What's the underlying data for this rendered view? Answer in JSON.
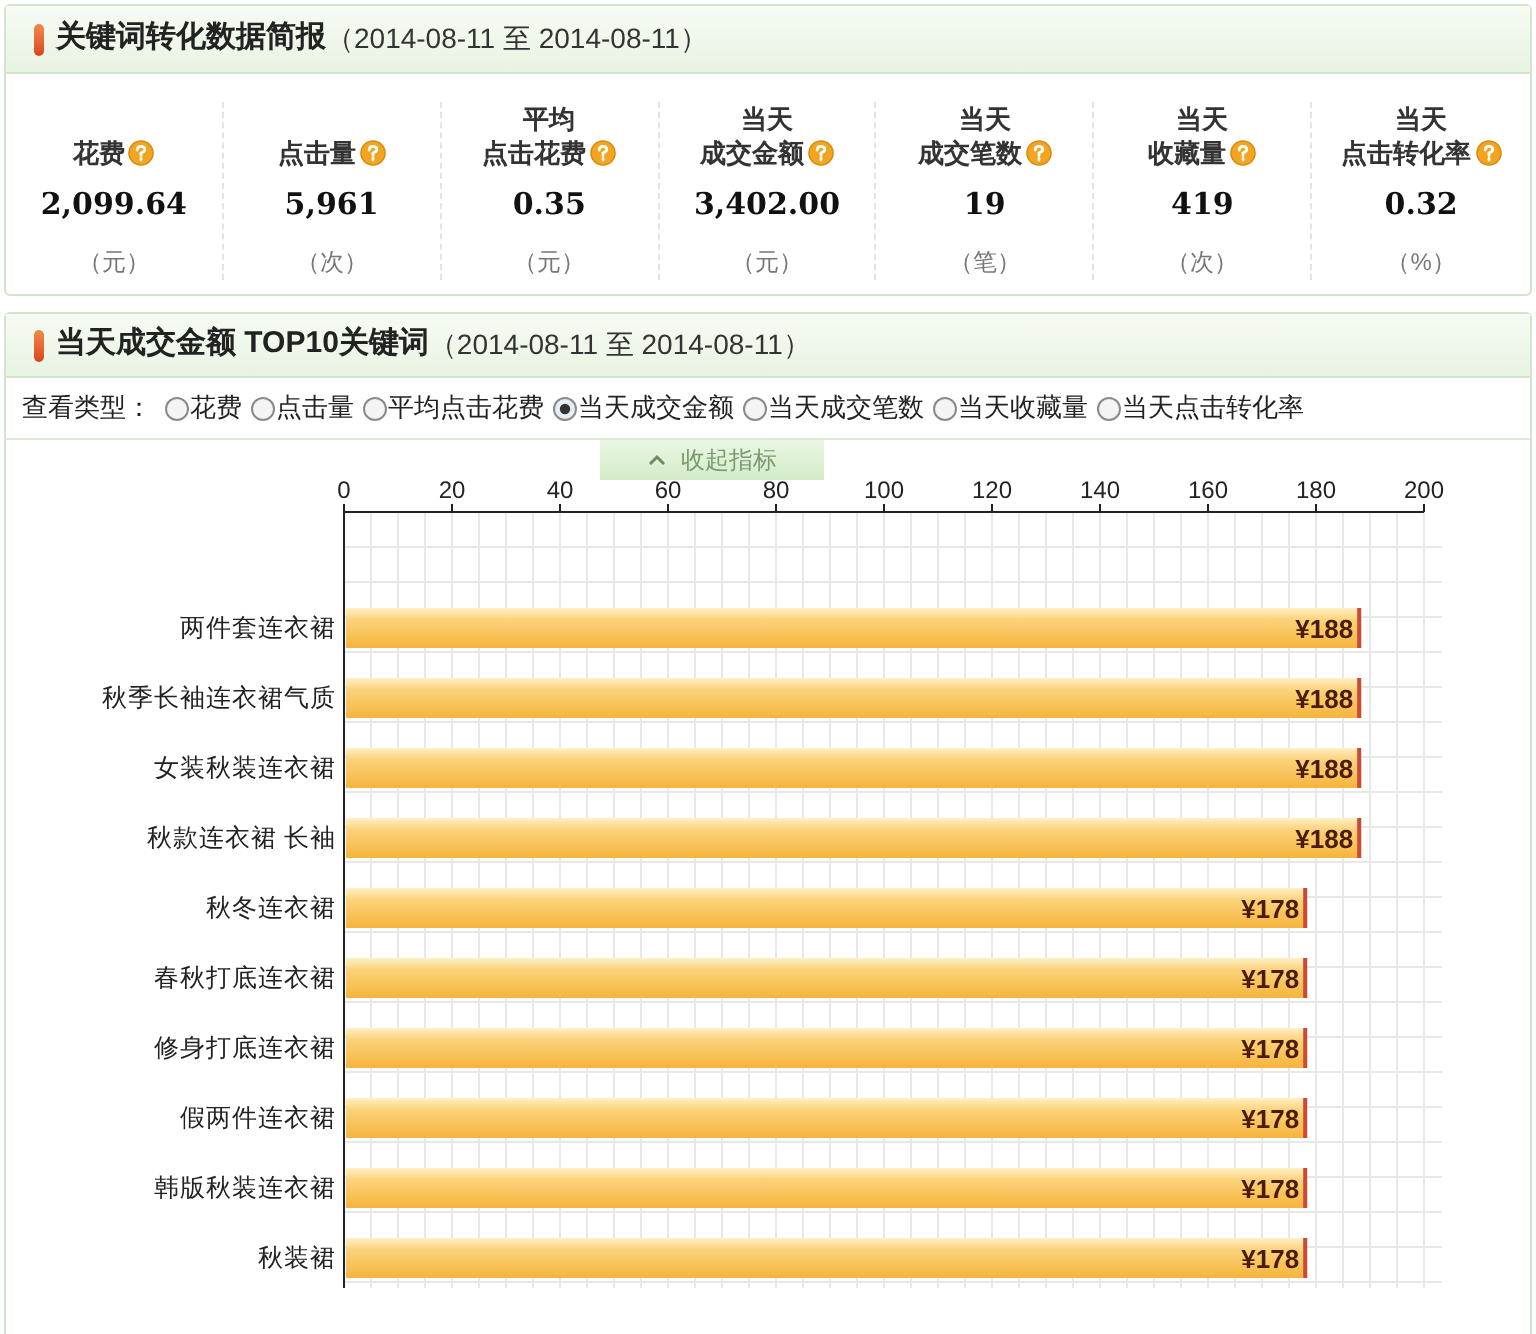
{
  "summary": {
    "title": "关键词转化数据简报",
    "date_range": "（2014-08-11 至 2014-08-11）",
    "stats": [
      {
        "label_lines": [
          "花费"
        ],
        "value": "2,099.64",
        "unit": "（元）"
      },
      {
        "label_lines": [
          "点击量"
        ],
        "value": "5,961",
        "unit": "（次）"
      },
      {
        "label_lines": [
          "平均",
          "点击花费"
        ],
        "value": "0.35",
        "unit": "（元）"
      },
      {
        "label_lines": [
          "当天",
          "成交金额"
        ],
        "value": "3,402.00",
        "unit": "（元）"
      },
      {
        "label_lines": [
          "当天",
          "成交笔数"
        ],
        "value": "19",
        "unit": "（笔）"
      },
      {
        "label_lines": [
          "当天",
          "收藏量"
        ],
        "value": "419",
        "unit": "（次）"
      },
      {
        "label_lines": [
          "当天",
          "点击转化率"
        ],
        "value": "0.32",
        "unit": "（%）"
      }
    ]
  },
  "top10": {
    "title": "当天成交金额 TOP10关键词",
    "date_range": "（2014-08-11 至 2014-08-11）",
    "view_type_label": "查看类型：",
    "view_types": [
      {
        "label": "花费",
        "selected": false
      },
      {
        "label": "点击量",
        "selected": false
      },
      {
        "label": "平均点击花费",
        "selected": false
      },
      {
        "label": "当天成交金额",
        "selected": true
      },
      {
        "label": "当天成交笔数",
        "selected": false
      },
      {
        "label": "当天收藏量",
        "selected": false
      },
      {
        "label": "当天点击转化率",
        "selected": false
      }
    ],
    "collapse_button": "收起指标",
    "chart_data": {
      "type": "bar",
      "orientation": "horizontal",
      "categories": [
        "两件套连衣裙",
        "秋季长袖连衣裙气质",
        "女装秋装连衣裙",
        "秋款连衣裙 长袖",
        "秋冬连衣裙",
        "春秋打底连衣裙",
        "修身打底连衣裙",
        "假两件连衣裙",
        "韩版秋装连衣裙",
        "秋装裙"
      ],
      "values": [
        188,
        188,
        188,
        188,
        178,
        178,
        178,
        178,
        178,
        178
      ],
      "grid": true,
      "value_labels": [
        "¥188",
        "¥188",
        "¥188",
        "¥188",
        "¥178",
        "¥178",
        "¥178",
        "¥178",
        "¥178",
        "¥178"
      ],
      "xlim": [
        0,
        200
      ],
      "xticks": [
        0,
        20,
        40,
        60,
        80,
        100,
        120,
        140,
        160,
        180,
        200
      ]
    }
  }
}
